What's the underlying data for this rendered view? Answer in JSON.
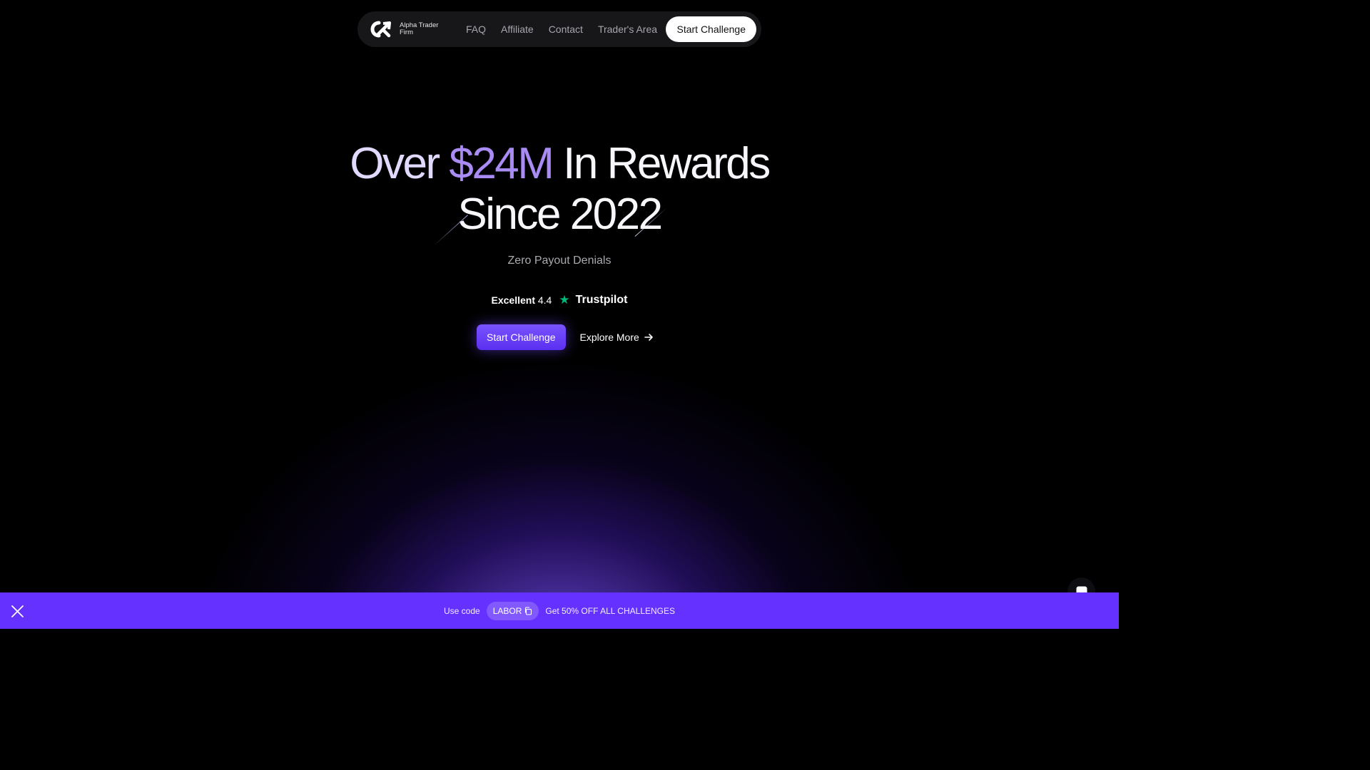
{
  "nav": {
    "brand": "Alpha Trader Firm",
    "links": [
      "FAQ",
      "Affiliate",
      "Contact",
      "Trader's Area"
    ],
    "cta": "Start Challenge"
  },
  "hero": {
    "headline_over": "Over",
    "headline_amount": "$24M",
    "headline_rest": "In Rewards",
    "headline_line2": "Since 2022",
    "subtitle": "Zero Payout Denials",
    "trust_label": "Excellent",
    "trust_score": "4.4",
    "trust_brand": "Trustpilot",
    "primary_cta": "Start Challenge",
    "secondary_cta": "Explore More"
  },
  "promo": {
    "prefix": "Use code",
    "code": "LABOR",
    "offer": "Get 50% OFF ALL CHALLENGES"
  },
  "icons": {
    "logo": "alpha-logo-icon",
    "arrow": "arrow-right-icon",
    "star": "trustpilot-star-icon",
    "copy": "copy-icon",
    "close": "close-icon",
    "chat": "chat-icon"
  },
  "colors": {
    "accent": "#6531ff",
    "amount": "#a98bf4",
    "trustpilot": "#00b67a"
  }
}
